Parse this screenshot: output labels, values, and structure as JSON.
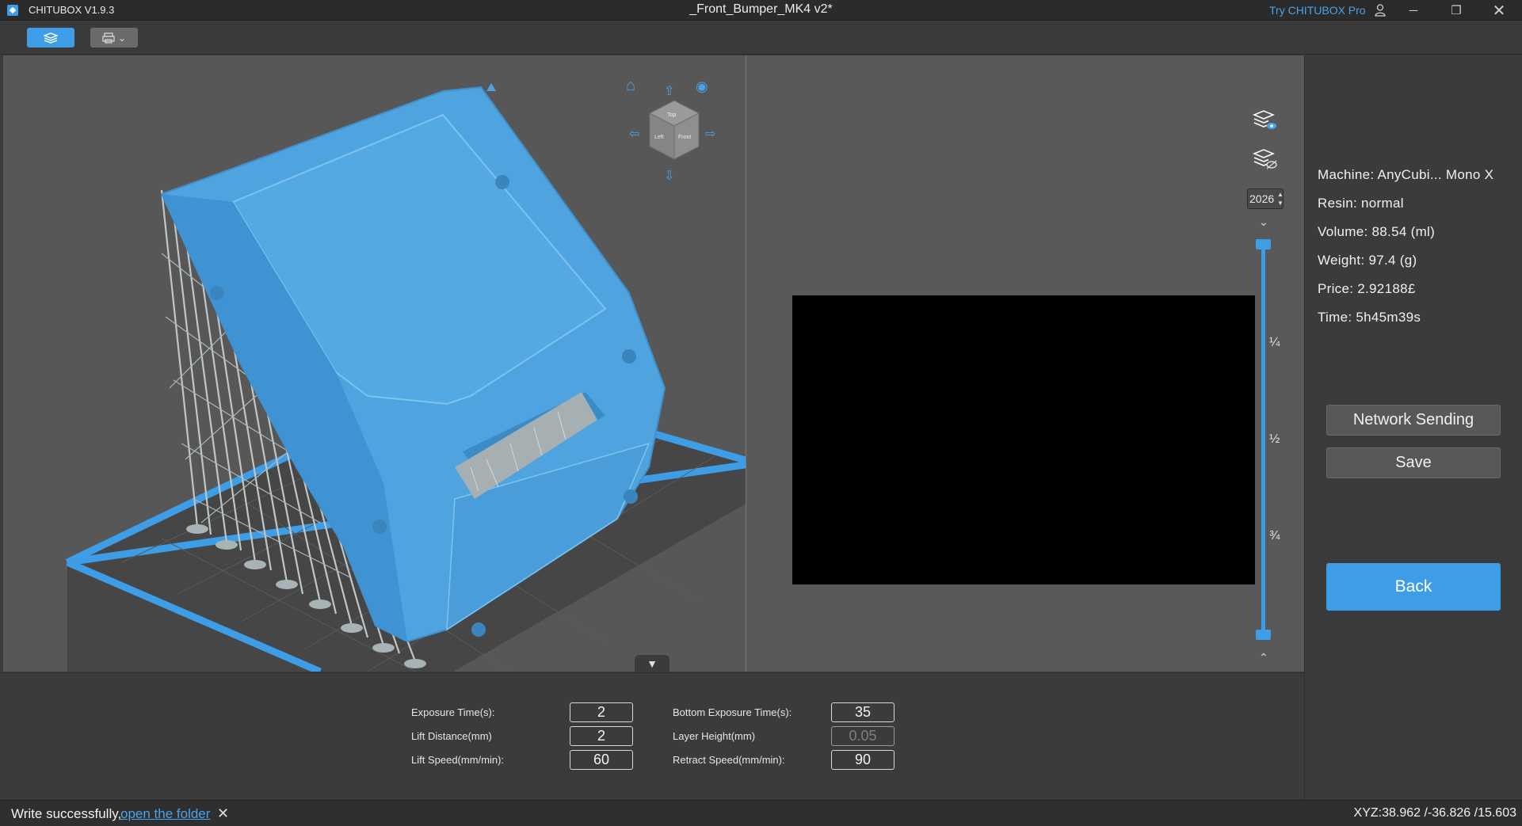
{
  "window": {
    "app_title": "CHITUBOX V1.9.3",
    "file_title": "_Front_Bumper_MK4 v2*",
    "try_pro": "Try CHITUBOX Pro",
    "close_glyph": "✕",
    "minimize_glyph": "─",
    "restore_glyph": "❐"
  },
  "toolbar": {
    "slice_mode_icon": "layers-icon",
    "print_mode_icon": "printer-icon",
    "dropdown_glyph": "⌄"
  },
  "viewport": {
    "model_name": "_Front_Bumper_MK4 v2",
    "model_color": "#4fa3de",
    "plate_border_color": "#3d9de6",
    "nav_cube_faces": {
      "top": "Top",
      "left": "Left",
      "front": "Front"
    },
    "collapse_glyph": "▼"
  },
  "layer_slider": {
    "current_layer": "2026",
    "fraction": 1.0,
    "ticks": [
      "¼",
      "½",
      "¾"
    ],
    "spin_glyphs": "▲▼",
    "down_glyph": "⌄",
    "up_glyph": "⌃"
  },
  "info": {
    "machine": "Machine:  AnyCubi... Mono X",
    "resin": "Resin:  normal",
    "volume": "Volume:  88.54  (ml)",
    "weight": "Weight:  97.4  (g)",
    "price": "Price:  2.92188£",
    "time": "Time:  5h45m39s",
    "network_button": "Network Sending",
    "save_button": "Save",
    "back_button": "Back"
  },
  "settings": {
    "exposure_time": {
      "label": "Exposure Time(s):",
      "value": "2"
    },
    "lift_distance": {
      "label": "Lift Distance(mm)",
      "value": "2"
    },
    "lift_speed": {
      "label": "Lift Speed(mm/min):",
      "value": "60"
    },
    "bottom_exposure": {
      "label": "Bottom Exposure Time(s):",
      "value": "35"
    },
    "layer_height": {
      "label": "Layer Height(mm)",
      "value": "0.05"
    },
    "retract_speed": {
      "label": "Retract Speed(mm/min):",
      "value": "90"
    }
  },
  "status": {
    "message": "Write successfully,",
    "link": "open the folder",
    "close_glyph": "✕",
    "xyz": "XYZ:38.962 /-36.826 /15.603"
  }
}
